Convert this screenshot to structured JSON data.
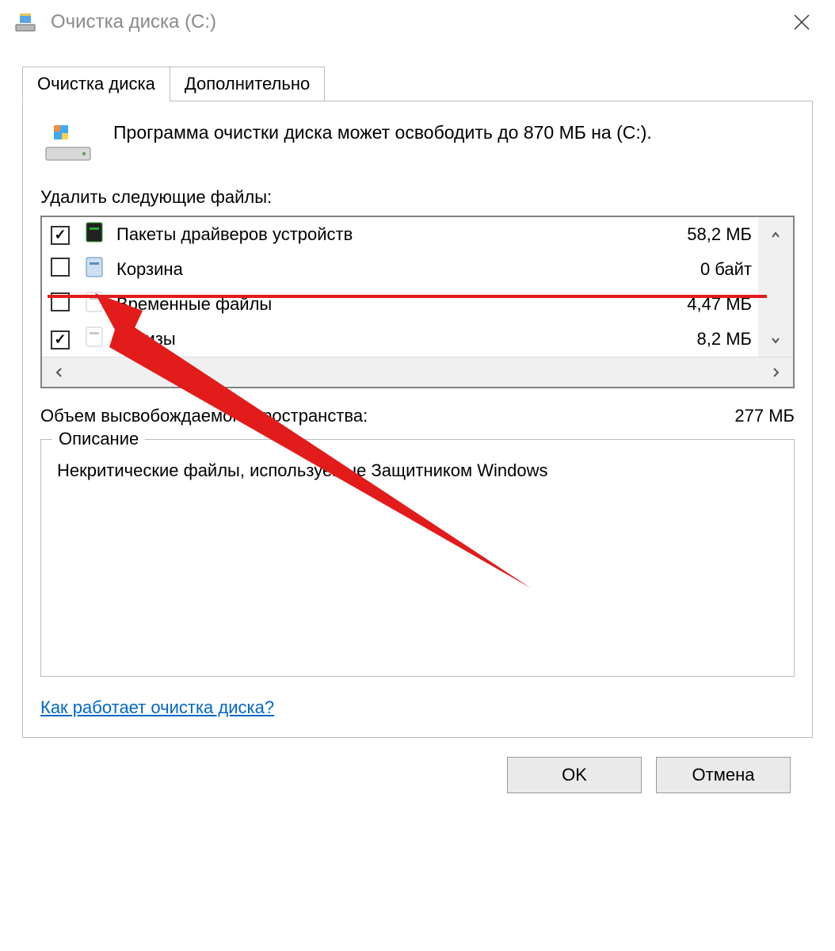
{
  "window": {
    "title": "Очистка диска  (C:)"
  },
  "tabs": {
    "cleanup": "Очистка диска",
    "more": "Дополнительно"
  },
  "summary": "Программа очистки диска может освободить до 870 МБ на  (C:).",
  "filesLabel": "Удалить следующие файлы:",
  "files": [
    {
      "name": "Пакеты драйверов устройств",
      "size": "58,2 МБ",
      "checked": true,
      "iconColor1": "#222",
      "iconColor2": "#2da82d"
    },
    {
      "name": "Корзина",
      "size": "0 байт",
      "checked": false,
      "iconColor1": "#cddff0",
      "iconColor2": "#5a8fbd"
    },
    {
      "name": "Временные файлы",
      "size": "4,47 МБ",
      "checked": false,
      "iconColor1": "#fff",
      "iconColor2": "#c8c8c8"
    },
    {
      "name": "Эскизы",
      "size": "8,2 МБ",
      "checked": true,
      "iconColor1": "#fff",
      "iconColor2": "#c8c8c8"
    }
  ],
  "totalLabel": "Объем высвобождаемого пространства:",
  "totalValue": "277 МБ",
  "description": {
    "legend": "Описание",
    "body": "Некритические файлы, используемые Защитником Windows"
  },
  "helpLink": "Как работает очистка диска?",
  "buttons": {
    "ok": "OK",
    "cancel": "Отмена"
  },
  "annotation": {
    "color": "#e21b1b"
  }
}
